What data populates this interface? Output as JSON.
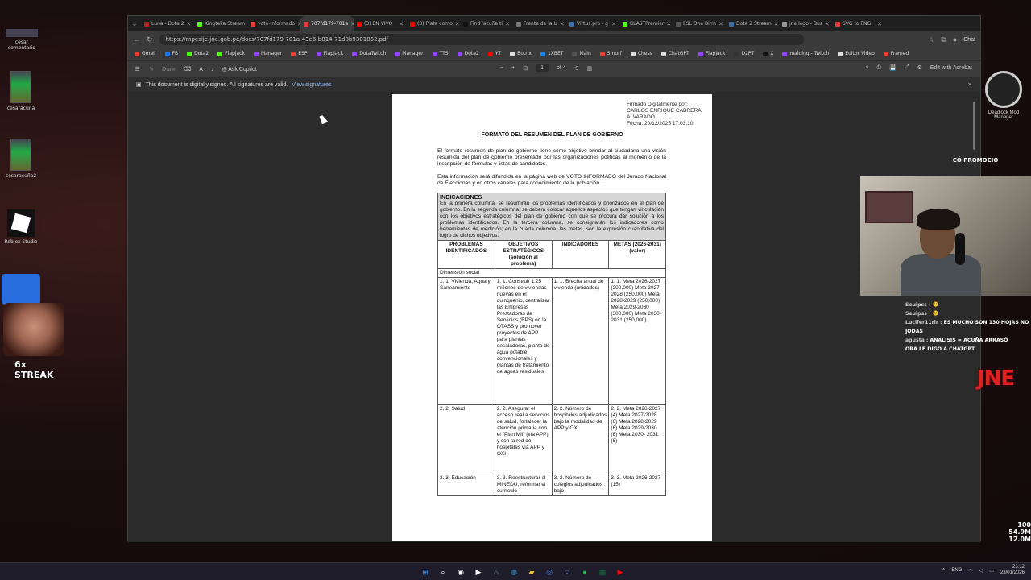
{
  "desktop": {
    "icons": [
      {
        "name": "desktop-icon-cesar-comentario",
        "label": "cesar comentario"
      },
      {
        "name": "desktop-icon-cesaracuna",
        "label": "cesaracuña"
      },
      {
        "name": "desktop-icon-cesaracuna2",
        "label": "cesaracuña2"
      },
      {
        "name": "desktop-icon-roblox-studio",
        "label": "Roblox Studio"
      }
    ]
  },
  "browser": {
    "tabs": [
      {
        "label": "Luna - Dota 2",
        "color": "#b22222",
        "active": false
      },
      {
        "label": "Kingteka Stream",
        "color": "#53fc18",
        "active": false
      },
      {
        "label": "voto-informado",
        "color": "#e53935",
        "active": false
      },
      {
        "label": "707fd179-701a",
        "color": "#e53935",
        "active": true
      },
      {
        "label": "(3) EN VIVO",
        "color": "#ff0000",
        "active": false
      },
      {
        "label": "(3) Plata como",
        "color": "#ff0000",
        "active": false
      },
      {
        "label": "Find 'acuña ti",
        "color": "#111111",
        "active": false
      },
      {
        "label": "Frente de la U",
        "color": "#777777",
        "active": false
      },
      {
        "label": "Virtus.pro - g",
        "color": "#3b6ea5",
        "active": false
      },
      {
        "label": "BLASTPremier",
        "color": "#53fc18",
        "active": false
      },
      {
        "label": "ESL One Birm",
        "color": "#555555",
        "active": false
      },
      {
        "label": "Dota 2 Stream",
        "color": "#3b6ea5",
        "active": false
      },
      {
        "label": "jne logo - Bus",
        "color": "#999999",
        "active": false
      },
      {
        "label": "SVG to PNG",
        "color": "#e53935",
        "active": false
      }
    ],
    "url": "https://mpesije.jne.gob.pe/docs/707fd179-701a-43e6-b814-71d8b9301852.pdf",
    "bookmarks": [
      {
        "label": "Gmail",
        "color": "#ea4335"
      },
      {
        "label": "FB",
        "color": "#1877f2"
      },
      {
        "label": "Dota2",
        "color": "#53fc18"
      },
      {
        "label": "Flapjack",
        "color": "#53fc18"
      },
      {
        "label": "Manager",
        "color": "#9146ff"
      },
      {
        "label": "ESP",
        "color": "#ea4335"
      },
      {
        "label": "Flapjack",
        "color": "#9146ff"
      },
      {
        "label": "DotaTwitch",
        "color": "#9146ff"
      },
      {
        "label": "Manager",
        "color": "#9146ff"
      },
      {
        "label": "TTS",
        "color": "#9146ff"
      },
      {
        "label": "Dota2",
        "color": "#9146ff"
      },
      {
        "label": "YT",
        "color": "#ff0000"
      },
      {
        "label": "Botrix",
        "color": "#dddddd"
      },
      {
        "label": "1XBET",
        "color": "#1e88e5"
      },
      {
        "label": "Main",
        "color": "#555555"
      },
      {
        "label": "Smurf",
        "color": "#ea4335"
      },
      {
        "label": "Chess",
        "color": "#dddddd"
      },
      {
        "label": "ChatGPT",
        "color": "#dddddd"
      },
      {
        "label": "Flapjack",
        "color": "#9146ff"
      },
      {
        "label": "D2PT",
        "color": "#333333"
      },
      {
        "label": "X",
        "color": "#111111"
      },
      {
        "label": "malding - Twitch",
        "color": "#9146ff"
      },
      {
        "label": "Editor Video",
        "color": "#dddddd"
      },
      {
        "label": "Framed",
        "color": "#ea4335"
      }
    ],
    "chat_label": "Chat"
  },
  "pdf": {
    "toolbar": {
      "draw": "Draw",
      "ask_copilot": "Ask Copilot",
      "minus": "−",
      "plus": "+",
      "page_current": "1",
      "page_total": "of 4",
      "edit_acrobat": "Edit with Acrobat"
    },
    "signature_notice": "This document is digitally signed. All signatures are valid.",
    "view_signatures": "View signatures",
    "document": {
      "signature": [
        "Firmado Digitalmente por:",
        "CARLOS ENRIQUE CABRERA",
        "ALVARADO",
        "Fecha: 20/12/2025 17:03:10"
      ],
      "title": "FORMATO DEL RESUMEN DEL PLAN DE GOBIERNO",
      "para1": "El formato resumen de plan de gobierno tiene como objetivo brindar al ciudadano una visión resumida del plan de gobierno presentado por las organizaciones políticas al momento de la inscripción de fórmulas y listas de candidatos.",
      "para2": "Esta información será difundida en la página web de VOTO INFORMADO del Jurado Nacional de Elecciones y en otros canales para conocimiento de la población.",
      "indicaciones_title": "INDICACIONES",
      "indicaciones_text": "En la primera columna, se resumirán los problemas identificados y priorizados en el plan de gobierno. En la segunda columna, se deberá colocar aquellos aspectos que tengan vinculación con los objetivos estratégicos del plan de gobierno con que se procura dar solución a los problemas identificados. En la tercera columna, se consignarán los indicadores como herramientas de medición; en la cuarta columna, las metas, son la expresión cuantitativa del logro de dichos objetivos.",
      "headers": [
        "PROBLEMAS IDENTIFICADOS",
        "OBJETIVOS ESTRATÉGICOS (solución al problema)",
        "INDICADORES",
        "METAS (2026-2031) (valor)"
      ],
      "dimension": "Dimensión social",
      "rows": [
        [
          "1. 1. Vivienda, Agua y Saneamiento",
          "1. 1. Construir 1.25 millones de viviendas nuevas en el quinquenio, centralizar las Empresas Prestadoras de Servicios (EPS) en la OTASS y promover proyectos de APP para plantas desaladoras, planta de agua potable convencionales y plantas de tratamiento de aguas residuales",
          "1. 1. Brecha anual de vivienda (unidades)",
          "1. 1. Meta 2026-2027 (200,000) Meta 2027-2028 (250,000) Meta 2028-2029 (250,000) Meta 2029-2030 (300,000) Meta 2030-2031 (250,000)"
        ],
        [
          "2. 2. Salud",
          "2. 2. Asegurar el acceso real a servicios de salud, fortalecer la atención primaria con el \"Plan Mil\" (vía APP) y con la red de hospitales vía APP y OXI",
          "2. 2. Número de hospitales adjudicados bajo la modalidad de APP y OXI",
          "2. 2. Meta 2026-2027 (4) Meta 2027-2028 (6) Meta 2028-2029 (6) Meta 2029-2030 (8) Meta 2030- 2031 (8)"
        ],
        [
          "3. 3. Educación",
          "3. 3. Reestructurar el MINEDU, reformar el currículo",
          "3. 3. Número de colegios adjudicados bajo",
          "3. 3. Meta 2026-2027 (15)"
        ]
      ]
    }
  },
  "overlays": {
    "deadlock": "Deadlock Mod Manager",
    "promo": "CÓ PROMOCIÓ",
    "streak": "6x STREAK",
    "jne": "JNE",
    "chat": [
      {
        "user": "Seulpss :",
        "msg": "🫠"
      },
      {
        "user": "Seulpss :",
        "msg": "🫠"
      },
      {
        "user": "Lucifer11rlr :",
        "msg": "ES MUCHO SON 130 HOJAS NO JODAS"
      },
      {
        "user": "agusta :",
        "msg": "ANALISIS = ACUÑA ARRASÓ"
      },
      {
        "user": "",
        "msg": "ORA LE DIGO A CHATGPT"
      }
    ],
    "stats": [
      "100",
      "54.9M",
      "12.0M"
    ]
  },
  "taskbar": {
    "lang": "ENG",
    "time": "23:12",
    "date": "23/01/2026"
  }
}
